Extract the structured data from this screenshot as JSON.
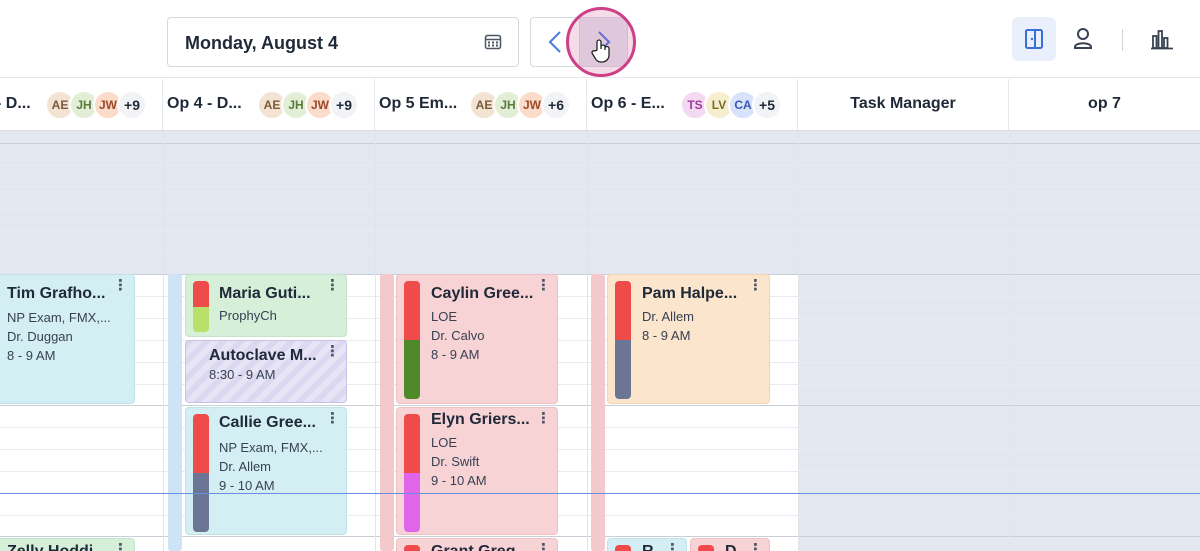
{
  "toolbar": {
    "date_label": "Monday, August 4",
    "prev_label": "‹",
    "next_label": "›"
  },
  "columns": [
    {
      "title": "- D...",
      "avatars": [
        {
          "initials": "AE",
          "bg": "#f3e3d3",
          "fg": "#7a5a3a"
        },
        {
          "initials": "JH",
          "bg": "#e2efd6",
          "fg": "#5a7a3a"
        },
        {
          "initials": "JW",
          "bg": "#fbdccb",
          "fg": "#9a4a2a"
        }
      ],
      "more": "+9"
    },
    {
      "title": "Op 4 - D...",
      "avatars": [
        {
          "initials": "AE",
          "bg": "#f3e3d3",
          "fg": "#7a5a3a"
        },
        {
          "initials": "JH",
          "bg": "#e2efd6",
          "fg": "#5a7a3a"
        },
        {
          "initials": "JW",
          "bg": "#fbdccb",
          "fg": "#9a4a2a"
        }
      ],
      "more": "+9"
    },
    {
      "title": "Op 5 Em...",
      "avatars": [
        {
          "initials": "AE",
          "bg": "#f3e3d3",
          "fg": "#7a5a3a"
        },
        {
          "initials": "JH",
          "bg": "#e2efd6",
          "fg": "#5a7a3a"
        },
        {
          "initials": "JW",
          "bg": "#fbdccb",
          "fg": "#9a4a2a"
        }
      ],
      "more": "+6"
    },
    {
      "title": "Op 6 - E...",
      "avatars": [
        {
          "initials": "TS",
          "bg": "#f3d9f1",
          "fg": "#a03aa0"
        },
        {
          "initials": "LV",
          "bg": "#f6efcf",
          "fg": "#7a6a2a"
        },
        {
          "initials": "CA",
          "bg": "#d8e2fb",
          "fg": "#3a5ab0"
        }
      ],
      "more": "+5"
    },
    {
      "title": "Task Manager"
    },
    {
      "title": "op 7"
    }
  ],
  "appointments": [
    {
      "name": "Tim Grafho...",
      "lines": [
        "NP Exam, FMX,...",
        "Dr. Duggan",
        "8 - 9 AM"
      ],
      "menu": "⋮"
    },
    {
      "name": "Maria Guti...",
      "lines": [
        "ProphyCh"
      ],
      "menu": "⋮"
    },
    {
      "name": "Autoclave M...",
      "lines": [
        "8:30 - 9 AM"
      ],
      "menu": "⋮"
    },
    {
      "name": "Callie Gree...",
      "lines": [
        "NP Exam, FMX,...",
        "Dr. Allem",
        "9 - 10 AM"
      ],
      "menu": "⋮"
    },
    {
      "name": "Caylin Gree...",
      "lines": [
        "LOE",
        "Dr. Calvo",
        "8 - 9 AM"
      ],
      "menu": "⋮"
    },
    {
      "name": "Elyn Griers...",
      "lines": [
        "LOE",
        "Dr. Swift",
        "9 - 10 AM"
      ],
      "menu": "⋮"
    },
    {
      "name": "Pam Halpe...",
      "lines": [
        "Dr. Allem",
        "8 - 9 AM"
      ],
      "menu": "⋮"
    },
    {
      "name": "Zelly Hoddi...",
      "lines": [],
      "menu": "⋮"
    },
    {
      "name": "Grant Greg...",
      "lines": [],
      "menu": "⋮"
    },
    {
      "name": "R...",
      "lines": [],
      "menu": "⋮"
    },
    {
      "name": "D...",
      "lines": [],
      "menu": "⋮"
    }
  ],
  "status_colors": {
    "red": "#ef4b4b",
    "lime": "#b9e06a",
    "dark_green": "#4f8a2a",
    "slate": "#6b7694",
    "magenta": "#e065e8",
    "accent_ring": "#cd3f86"
  }
}
